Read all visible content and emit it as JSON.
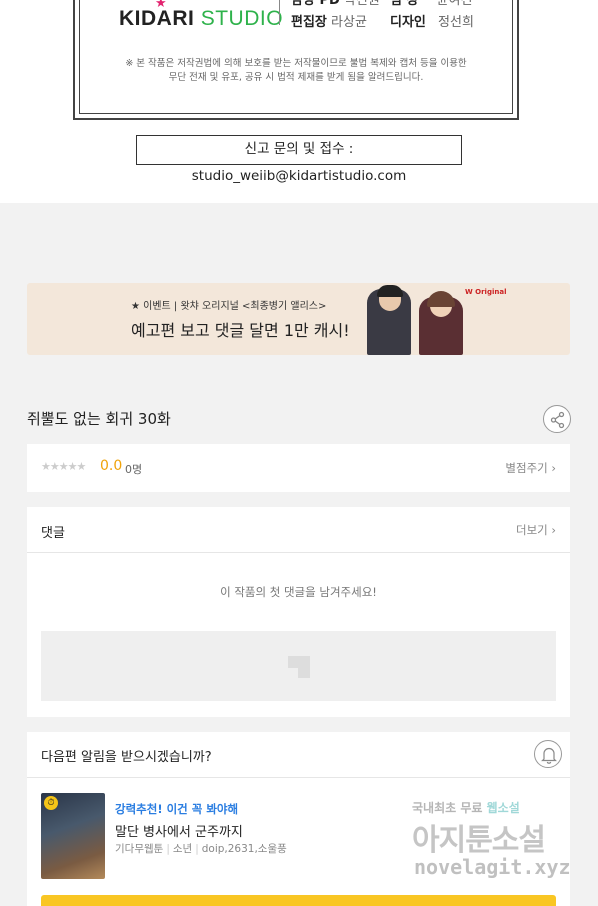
{
  "credits": {
    "logo_kid": "KID",
    "logo_a": "A",
    "logo_ri": "RI",
    "logo_studio": "STUDIO",
    "staff": [
      {
        "role": "담당 PD",
        "name": "박진원"
      },
      {
        "role": "팀  장",
        "name": "윤여건"
      },
      {
        "role": "편집장",
        "name": "라상균"
      },
      {
        "role": "디자인",
        "name": "정선희"
      }
    ],
    "notice_line1": "※ 본 작품은 저작권법에 의해 보호를 받는 저작물이므로 불법 복제와 캡처 등을 이용한",
    "notice_line2": "무단 전재 및 유포, 공유 시 법적 제재를 받게 됨을 알려드립니다.",
    "report": "신고 문의 및 접수 : studio_weiib@kidartistudio.com"
  },
  "banner": {
    "subtitle": "★ 이벤트 | 왓챠 오리지널 <최종병기 앨리스>",
    "title": "예고편 보고 댓글 달면 1만 캐시!",
    "badge": "W Original"
  },
  "episode": {
    "title": "쥐뿔도 없는 회귀 30화",
    "share_icon": "share-icon"
  },
  "rating": {
    "stars": "★★★★★",
    "score": "0.0",
    "count": "0명",
    "rate_link": "별점주기 ›"
  },
  "comments": {
    "header": "댓글",
    "more": "더보기 ›",
    "empty": "이 작품의 첫 댓글을 남겨주세요!"
  },
  "notify": {
    "question": "다음편 알림을 받으시겠습니까?",
    "bell_icon": "bell-icon",
    "rec_tag": "강력추천! 이건 꼭 봐야해",
    "rec_title": "말단 병사에서 군주까지",
    "rec_meta": [
      "기다무웹툰",
      "소년",
      "doip,2631,소울풍"
    ]
  },
  "watermark": {
    "line1a": "국내최초 무료 ",
    "line1b": "웹소설",
    "line2": "아지툰소설",
    "line3": "novelagit.xyz"
  },
  "colors": {
    "score": "#f0a30a",
    "rec_tag": "#2a7de1",
    "cta": "#f9c623",
    "banner_bg": "#f3e7da"
  }
}
